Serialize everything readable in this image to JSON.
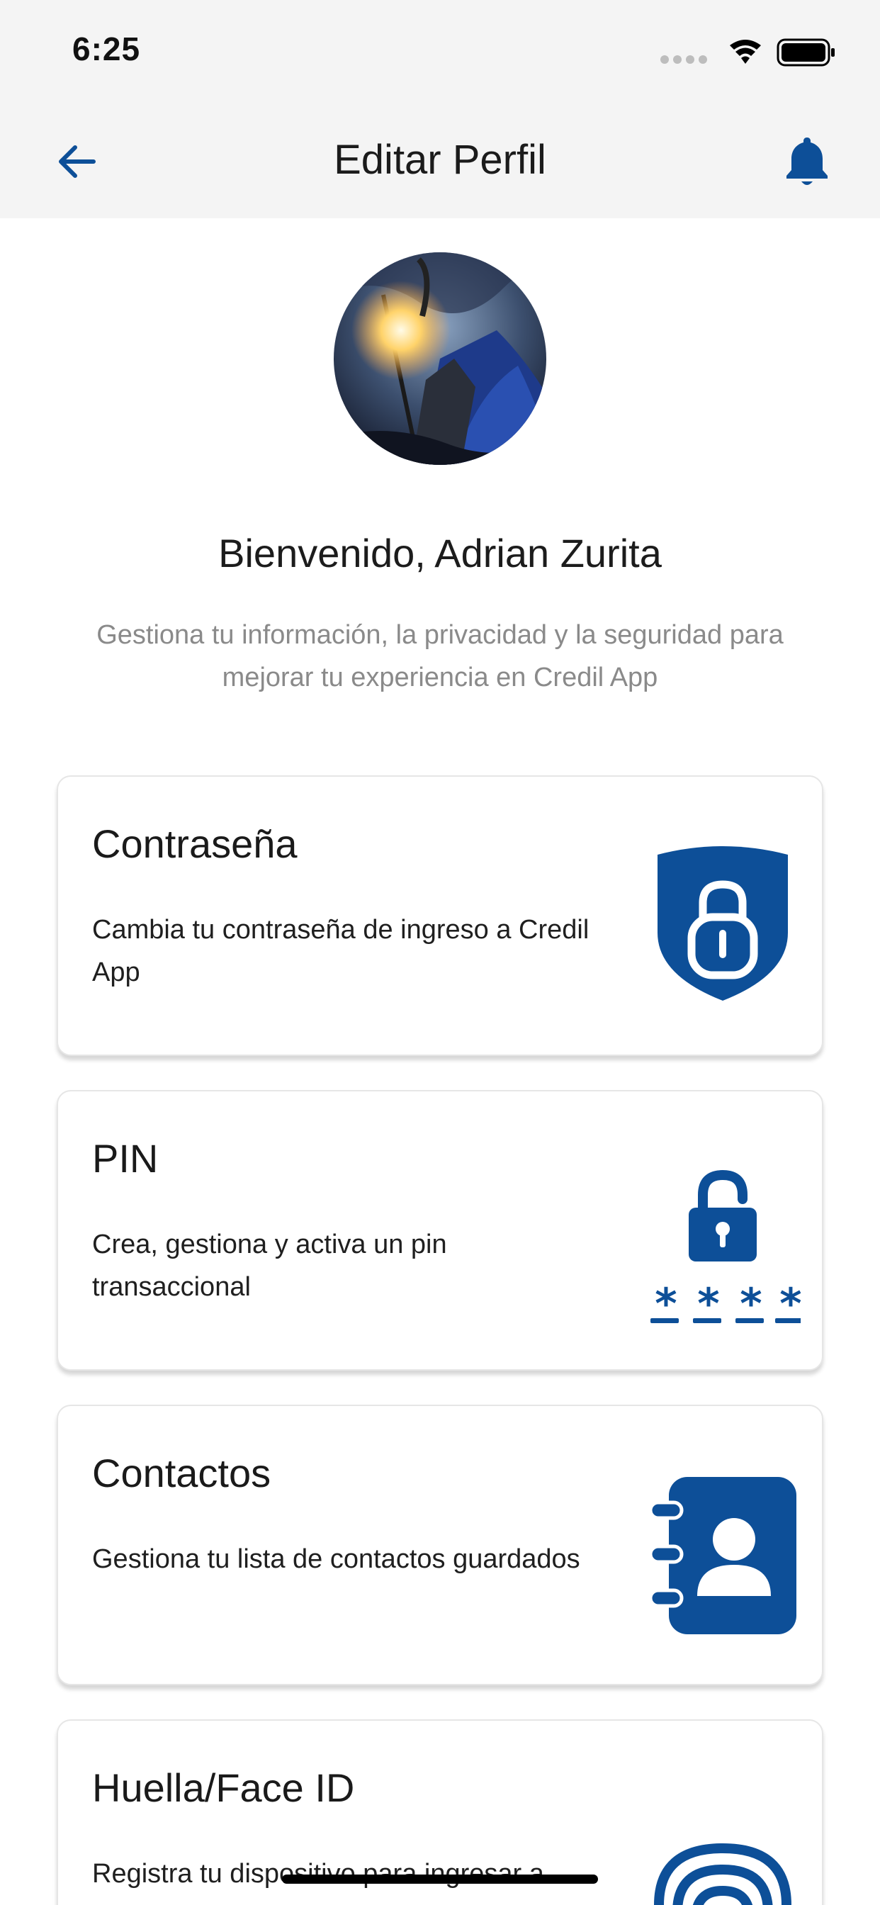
{
  "status_bar": {
    "time": "6:25"
  },
  "header": {
    "title": "Editar Perfil"
  },
  "profile": {
    "welcome": "Bienvenido, Adrian Zurita",
    "subtitle": "Gestiona tu información, la privacidad y la seguridad para mejorar tu experiencia en Credil App"
  },
  "colors": {
    "accent": "#0d4f98",
    "header_bg": "#f4f4f4"
  },
  "cards": [
    {
      "title": "Contraseña",
      "description": "Cambia tu contraseña de ingreso a Credil App",
      "icon": "shield-lock-icon"
    },
    {
      "title": "PIN",
      "description": "Crea, gestiona y activa un pin transaccional",
      "icon": "pin-lock-icon"
    },
    {
      "title": "Contactos",
      "description": "Gestiona tu lista de contactos guardados",
      "icon": "contacts-book-icon"
    },
    {
      "title": "Huella/Face ID",
      "description": "Registra tu dispositivo para ingresar a",
      "icon": "fingerprint-icon"
    }
  ]
}
